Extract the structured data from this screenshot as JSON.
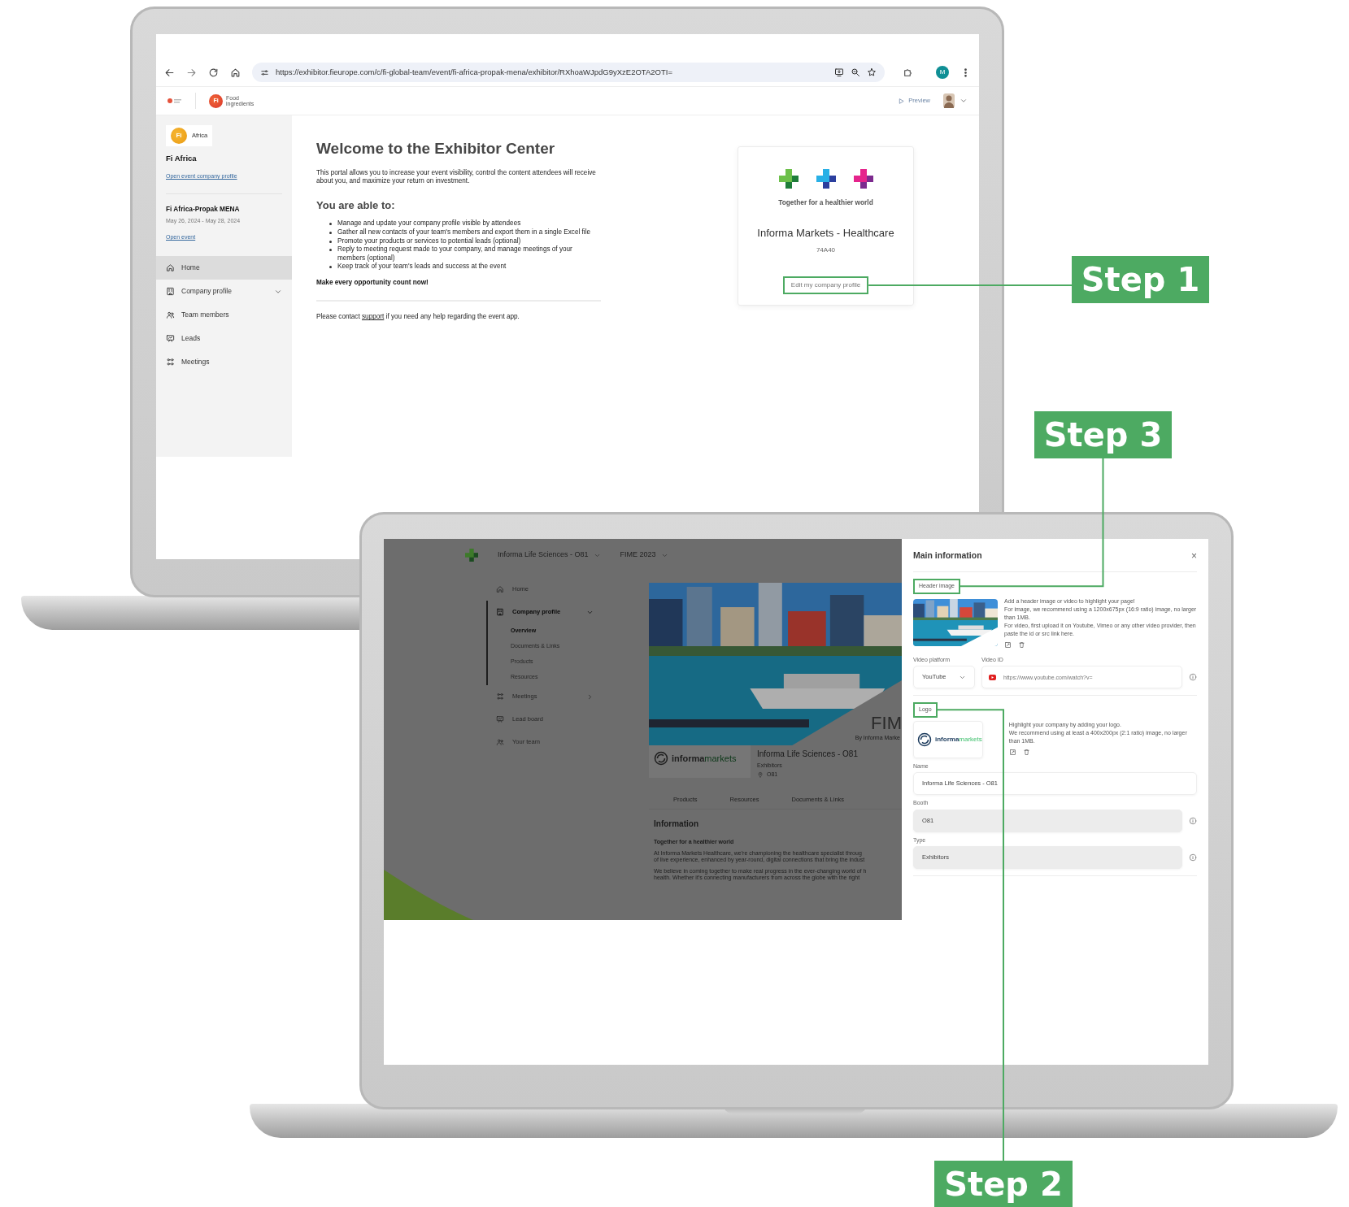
{
  "back_laptop": {
    "browser": {
      "url": "https://exhibitor.fieurope.com/c/fi-global-team/event/fi-africa-propak-mena/exhibitor/RXhoaWJpdG9yXzE2OTA2OTI=",
      "profile_initial": "M"
    },
    "header": {
      "brand_badge": "Fi",
      "brand_name": "Food ingredients",
      "preview": "Preview"
    },
    "sidebar": {
      "logo_badge": "Fi",
      "logo_text": "Africa",
      "company": "Fi Africa",
      "company_link": "Open event company profile",
      "event_name": "Fi Africa-Propak MENA",
      "event_dates": "May 26, 2024 - May 28, 2024",
      "event_link": "Open event",
      "items": [
        {
          "label": "Home",
          "selected": true
        },
        {
          "label": "Company profile",
          "selected": false,
          "expanded": false
        },
        {
          "label": "Team members",
          "selected": false
        },
        {
          "label": "Leads",
          "selected": false
        },
        {
          "label": "Meetings",
          "selected": false
        }
      ]
    },
    "main": {
      "title": "Welcome to the Exhibitor Center",
      "intro": "This portal allows you to increase your event visibility, control the content attendees will receive about you, and maximize your return on investment.",
      "subtitle": "You are able to:",
      "bullets": [
        "Manage and update your company profile visible by attendees",
        "Gather all new contacts of your team's members and export them in a single Excel file",
        "Promote your products or services to potential leads (optional)",
        "Reply to meeting request made to your company, and manage meetings of your members (optional)",
        "Keep track of your team's leads and success at the event"
      ],
      "cta": "Make every opportunity count now!",
      "contact": {
        "before": "Please contact",
        "link": "support",
        "after": "if you need any help regarding the event app."
      }
    },
    "company_card": {
      "tagline": "Together for a healthier world",
      "name": "Informa Markets - Healthcare",
      "booth": "74A40",
      "button": "Edit my company profile"
    }
  },
  "front_laptop": {
    "topbar": {
      "company": "Informa Life Sciences - O81",
      "event": "FIME 2023"
    },
    "sidebar": {
      "items": [
        {
          "label": "Home",
          "selected": false
        },
        {
          "label": "Company profile",
          "selected": true,
          "expanded": true,
          "children": [
            {
              "label": "Overview",
              "selected": true
            },
            {
              "label": "Documents & Links",
              "selected": false
            },
            {
              "label": "Products",
              "selected": false
            },
            {
              "label": "Resources",
              "selected": false
            }
          ]
        },
        {
          "label": "Meetings",
          "selected": false,
          "expanded": false
        },
        {
          "label": "Lead board",
          "selected": false
        },
        {
          "label": "Your team",
          "selected": false
        }
      ]
    },
    "profile": {
      "banner_title": "FIM",
      "banner_subtitle": "By Informa Marke",
      "logo_text": [
        "informa",
        "markets"
      ],
      "name": "Informa Life Sciences - O81",
      "type": "Exhibitors",
      "booth": "O81",
      "tabs": [
        "Products",
        "Resources",
        "Documents & Links"
      ],
      "section_title": "Information",
      "tagline": "Together for a healthier world",
      "paragraphs": [
        [
          "At Informa Markets Healthcare, we're championing the healthcare specialist throug",
          "of live experience, enhanced by year-round, digital connections that bring the indust"
        ],
        [
          "We believe in coming together to make real progress in the ever-changing world of h",
          "health. Whether it's connecting manufacturers from across the globe with the right"
        ]
      ]
    },
    "panel": {
      "title": "Main information",
      "close": "×",
      "header_image": {
        "label": "Header image",
        "help": [
          "Add a header image or video to highlight your page!",
          "For image, we recommend using a 1200x675px (16:9 ratio) image, no larger than 1MB.",
          "For video, first upload it on Youtube, Vimeo or any other video provider, then paste the id or src link here."
        ]
      },
      "video": {
        "platform_label": "Video platform",
        "platform": "YouTube",
        "id_label": "Video ID",
        "id_placeholder": "https://www.youtube.com/watch?v="
      },
      "logo": {
        "label": "Logo",
        "logo_text": [
          "informa",
          "markets"
        ],
        "help": [
          "Highlight your company by adding your logo.",
          "We recommend using at least a 400x200px (2:1 ratio) image, no larger than 1MB."
        ]
      },
      "fields": [
        {
          "label": "Name",
          "value": "Informa Life Sciences - O81",
          "disabled": false
        },
        {
          "label": "Booth",
          "value": "O81",
          "disabled": true
        },
        {
          "label": "Type",
          "value": "Exhibitors",
          "disabled": true
        }
      ]
    }
  },
  "steps": [
    {
      "label": "Step 1"
    },
    {
      "label": "Step 3"
    },
    {
      "label": "Step 2"
    }
  ]
}
